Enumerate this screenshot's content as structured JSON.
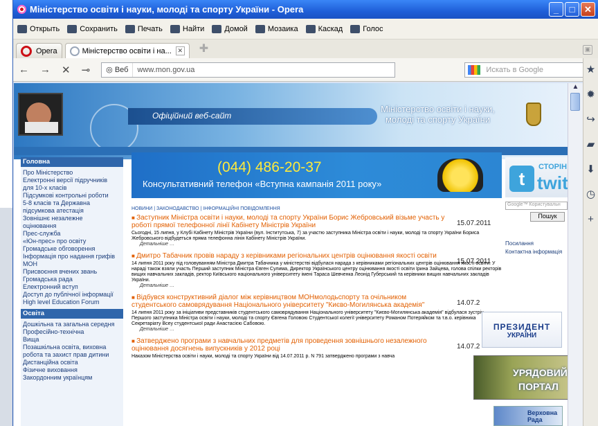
{
  "window": {
    "title": "Міністерство освіти і науки, молоді та спорту України - Opera"
  },
  "menu": [
    "Открыть",
    "Сохранить",
    "Печать",
    "Найти",
    "Домой",
    "Мозаика",
    "Каскад",
    "Голос"
  ],
  "tabs": [
    {
      "label": "Opera"
    },
    {
      "label": "Міністерство освіти і на..."
    }
  ],
  "nav": {
    "web_label": "Веб",
    "url": "www.mon.gov.ua",
    "search_placeholder": "Искать в Google"
  },
  "banner": {
    "official": "Офіційний веб-сайт",
    "ministry_line1": "Міністерство освіти і науки,",
    "ministry_line2": "молоді та спорту України"
  },
  "leftnav": {
    "section1": "Головна",
    "items1": [
      "Про Міністерство",
      "Електронні версії підручників",
      "для 10-х класів",
      "Підсумкові контрольні роботи",
      "5-8 класів та Державна",
      "підсумкова атестація",
      "Зовнішнє незалежне",
      "оцінювання",
      "Прес-служба",
      "«Юн-прес» про освіту",
      "Громадське обговорення",
      "Інформація про надання грифів",
      "МОН",
      "Присвоєння вчених звань",
      "Громадська рада",
      "Електронний вступ",
      "Доступ до публічної інформації",
      "High level Education Forum"
    ],
    "section2": "Освіта",
    "items2": [
      "Дошкільна та загальна середня",
      "Професійно-технічна",
      "Вища",
      "Позашкільна освіта, виховна",
      "робота та захист прав дитини",
      "Дистанційна освіта",
      "Фізичне виховання",
      "Закордонним українцям"
    ]
  },
  "hotline": {
    "number": "(044) 486-20-37",
    "caption": "Консультативний телефон «Вступна кампанія 2011 року»"
  },
  "subnav": {
    "news": "НОВИНИ",
    "law": "ЗАКОНОДАВСТВО",
    "info": "ІНФОРМАЦІЙНІ ПОВІДОМЛЕННЯ"
  },
  "news": [
    {
      "title": "Заступник Міністра освіти і науки, молоді та спорту України Борис Жебровський візьме участь у роботі прямої телефонної лінії Кабінету Міністрів України",
      "date": "15.07.2011",
      "body": "Сьогодні, 15 липня, у Клубі Кабінету Міністрів України (вул. Інститутська, 7) за участю заступника Міністра освіти і науки, молоді та спорту України Бориса Жебровського відбудеться пряма телефонна лінія Кабінету Міністрів України.",
      "more": "Детальніше …"
    },
    {
      "title": "Дмитро Табачник провів нараду з керівниками регіональних центрів оцінювання якості освіти",
      "date": "15.07.2011",
      "body": "14 липня 2011 року під головуванням Міністра Дмитра Табачника у міністерстві відбулася нарада з керівниками регіональних центрів оцінювання якості освіти. У нараді також взяли участь Перший заступник Міністра Євген Сулима, Директор Українського центру оцінювання якості освіти Ірина Зайцева, голова спілки ректорів вищих навчальних закладів, ректор Київського національного університету імені Тараса Шевченка Леонід Губерський та керівники вищих навчальних закладів України.",
      "more": "Детальніше …"
    },
    {
      "title": "Відбувся конструктивний діалог між керівництвом МОНмолодьспорту та очільником студентського самоврядування Національного університету \"Києво-Могилянська академія\"",
      "date": "14.07.2",
      "body": "14 липня 2011 року за ініціативи представників студентського самоврядування Національного університету \"Києво-Могилянська академія\" відбулася зустріч Першого заступника Міністра освіти і науки, молоді та спорту Євгена Головою Студентської колегії університету Романом Потеряйком та т.в.о. керівника Секретаріату Всеу студентської ради Анастасією Сабовою.",
      "more": "Детальніше …"
    },
    {
      "title": "Затверджено програми з навчальних предметів для проведення зовнішнього незалежного оцінювання досягнень випускників у 2012 році",
      "date": "14.07.2",
      "body": "Наказом Міністерства освіти і науки, молоді та спорту України від 14.07.2011 р. N 791 затверджено програми з навча",
      "more": ""
    }
  ],
  "rightcol": {
    "twitter_top": "СТОРІН",
    "twitter_word": "twit",
    "search_placeholder": "Google™ Користувальн",
    "search_button": "Пошук",
    "link1": "Посилання",
    "link2": "Контактна інформація"
  },
  "badges": {
    "president1": "ПРЕЗИДЕНТ",
    "president2": "УКРАЇНИ",
    "gov1": "УРЯДОВИЙ",
    "gov2": "ПОРТАЛ",
    "rada": "Верховна Рада"
  }
}
